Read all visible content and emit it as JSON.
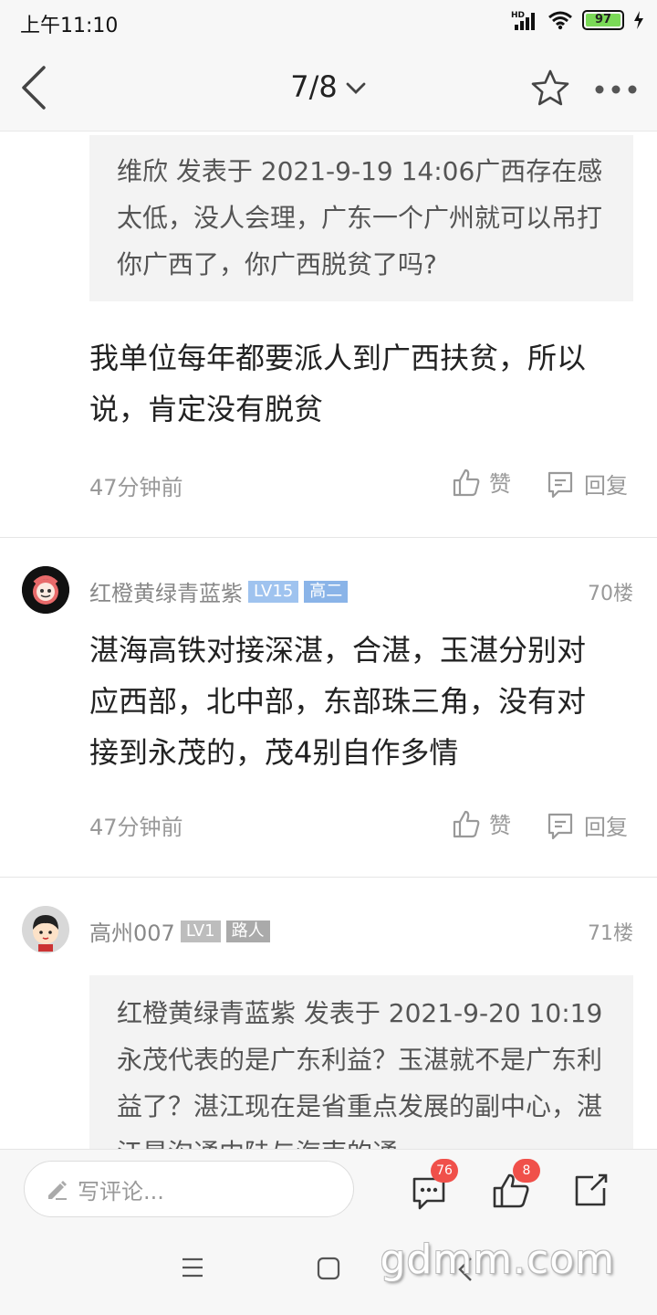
{
  "status": {
    "time": "上午11:10",
    "battery": "97",
    "network": "HD"
  },
  "header": {
    "page_indicator": "7/8"
  },
  "posts": [
    {
      "quote": "维欣 发表于 2021-9-19 14:06广西存在感太低，没人会理，广东一个广州就可以吊打你广西了，你广西脱贫了吗?",
      "body": "我单位每年都要派人到广西扶贫，所以说，肯定没有脱贫",
      "time": "47分钟前",
      "like_label": "赞",
      "reply_label": "回复"
    },
    {
      "username": "红橙黄绿青蓝紫",
      "level": "LV15",
      "rank": "高二",
      "floor": "70楼",
      "body": "湛海高铁对接深湛，合湛，玉湛分别对应西部，北中部，东部珠三角，没有对接到永茂的，茂4别自作多情",
      "time": "47分钟前",
      "like_label": "赞",
      "reply_label": "回复"
    },
    {
      "username": "高州007",
      "level": "LV1",
      "rank": "路人",
      "floor": "71楼",
      "quote": "红橙黄绿青蓝紫 发表于 2021-9-20 10:19永茂代表的是广东利益？玉湛就不是广东利益了？湛江现在是省重点发展的副中心，湛江是沟通内陆与海南的通"
    }
  ],
  "bottom": {
    "comment_placeholder": "写评论...",
    "comment_count": "76",
    "like_count": "8"
  },
  "watermark": "gdmm.com",
  "colors": {
    "level_badge": "#9fc3ef",
    "rank_badge": "#8ab4e8",
    "rank_badge_road": "#bdbdbd",
    "notif": "#f0504a"
  }
}
